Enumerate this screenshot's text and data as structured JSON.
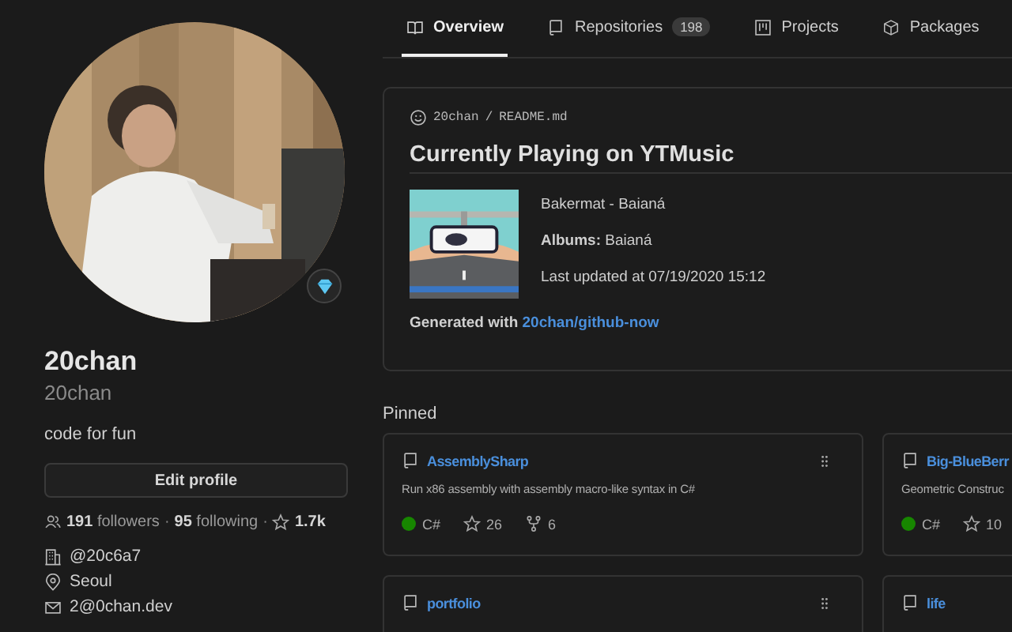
{
  "tabs": [
    {
      "label": "Overview",
      "selected": true
    },
    {
      "label": "Repositories",
      "count": "198",
      "selected": false
    },
    {
      "label": "Projects",
      "selected": false
    },
    {
      "label": "Packages",
      "selected": false
    }
  ],
  "profile": {
    "name": "20chan",
    "separator": "·",
    "login": "20chan",
    "bio": "code for fun",
    "edit_button": "Edit profile",
    "followers": "191",
    "followers_label": "followers",
    "following": "95",
    "following_label": "following",
    "stars": "1.7k",
    "details": [
      {
        "kind": "organization",
        "text": "@20c6a7"
      },
      {
        "kind": "location",
        "text": "Seoul"
      },
      {
        "kind": "email",
        "text": "2@0chan.dev"
      }
    ]
  },
  "readme": {
    "user": "20chan",
    "path_separator": "/",
    "file": "README.md",
    "heading": "Currently Playing on YTMusic",
    "track": "Bakermat - Baianá",
    "album_label": "Albums:",
    "album": "Baianá",
    "updated": "Last updated at 07/19/2020 15:12",
    "generated_label": "Generated with",
    "generated_link": "20chan/github-now"
  },
  "pinned": {
    "title": "Pinned",
    "repos": [
      {
        "name": "AssemblySharp",
        "description": "Run x86 assembly with assembly macro-like syntax in C#",
        "language": "C#",
        "color": "#178600",
        "stars": "26",
        "forks": "6"
      },
      {
        "name": "Big-BlueBerr",
        "description": "Geometric Construc",
        "language": "C#",
        "color": "#178600",
        "stars": "10"
      },
      {
        "name": "portfolio"
      },
      {
        "name": "life"
      }
    ]
  }
}
